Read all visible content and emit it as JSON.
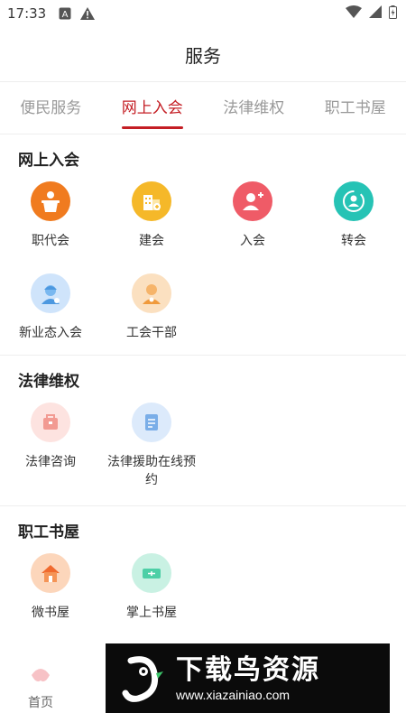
{
  "status_bar": {
    "time": "17:33"
  },
  "header": {
    "title": "服务"
  },
  "tabs": [
    {
      "label": "便民服务",
      "active": false
    },
    {
      "label": "网上入会",
      "active": true
    },
    {
      "label": "法律维权",
      "active": false
    },
    {
      "label": "职工书屋",
      "active": false
    }
  ],
  "sections": {
    "online_join": {
      "title": "网上入会",
      "items": [
        {
          "label": "职代会",
          "icon": "podium-icon",
          "color": "#f07b1f"
        },
        {
          "label": "建会",
          "icon": "building-icon",
          "color": "#f5b829"
        },
        {
          "label": "入会",
          "icon": "user-add-icon",
          "color": "#ef5b67"
        },
        {
          "label": "转会",
          "icon": "user-transfer-icon",
          "color": "#26c3b5"
        },
        {
          "label": "新业态入会",
          "icon": "worker-icon",
          "color": "#7ab8f0"
        },
        {
          "label": "工会干部",
          "icon": "cadre-icon",
          "color": "#f6b46a"
        }
      ]
    },
    "legal_rights": {
      "title": "法律维权",
      "items": [
        {
          "label": "法律咨询",
          "icon": "legal-consult-icon",
          "color": "#f29a92"
        },
        {
          "label": "法律援助在线预约",
          "icon": "legal-aid-icon",
          "color": "#7aaee8"
        }
      ]
    },
    "bookhouse": {
      "title": "职工书屋",
      "items": [
        {
          "label": "微书屋",
          "icon": "house-icon",
          "color": "#f59456"
        },
        {
          "label": "掌上书屋",
          "icon": "book-icon",
          "color": "#4dcfa6"
        }
      ]
    }
  },
  "bottom_nav": {
    "home_label": "首页"
  },
  "watermark": {
    "big": "下载鸟资源",
    "small": "www.xiazainiao.com"
  }
}
